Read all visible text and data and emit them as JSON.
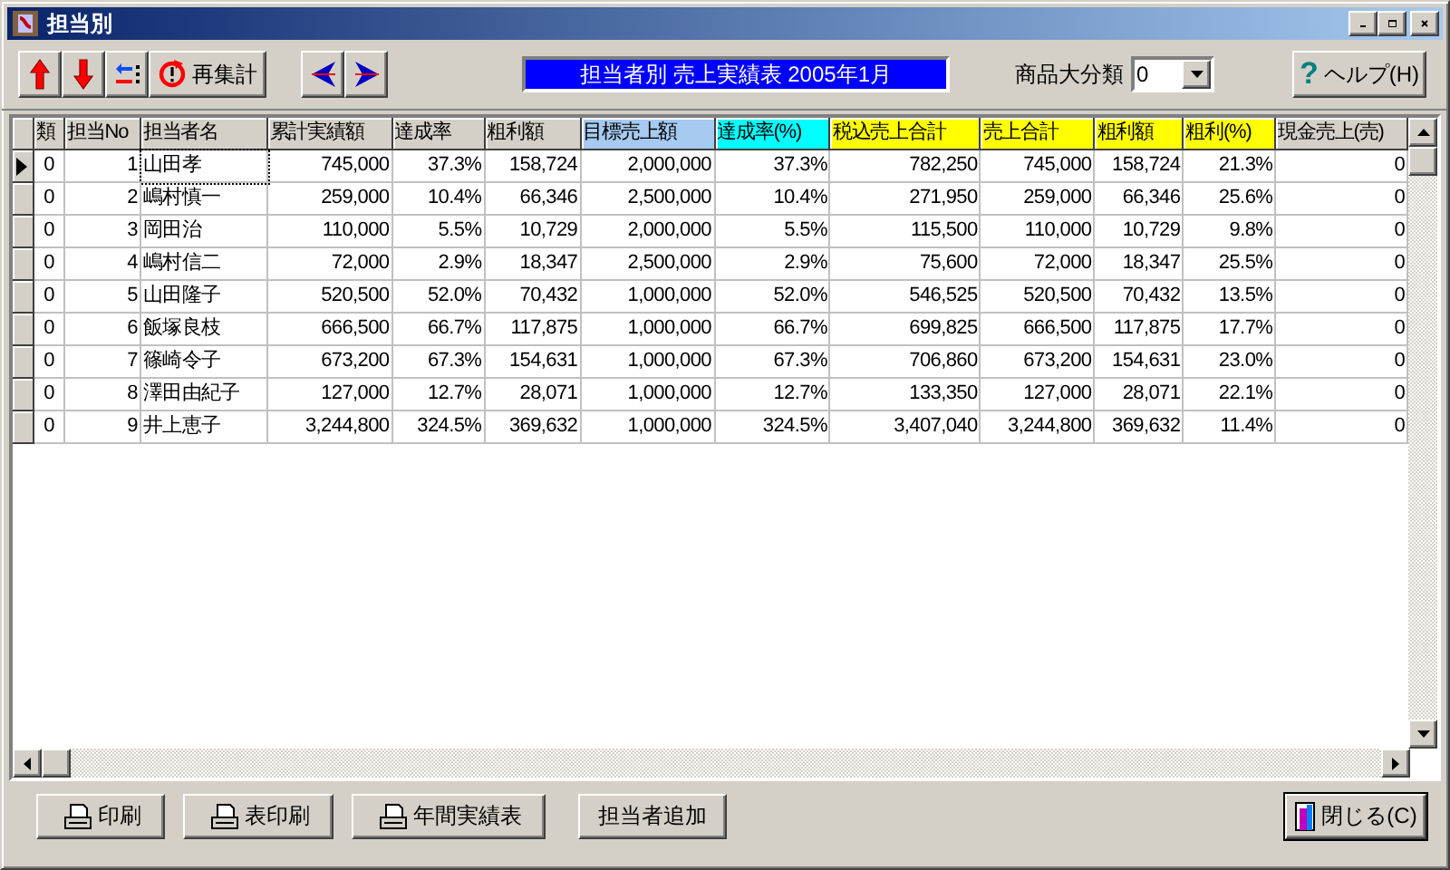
{
  "window": {
    "title": "担当別"
  },
  "toolbar": {
    "recalc_button": "再集計",
    "report_title": "担当者別  売上実績表 2005年1月",
    "category_label": "商品大分類",
    "category_value": "0",
    "help_icon": "?",
    "help_button": "ヘルプ(H)"
  },
  "table": {
    "columns": [
      {
        "label": "類",
        "color": "#d4d0c8"
      },
      {
        "label": "担当No",
        "color": "#d4d0c8"
      },
      {
        "label": "担当者名",
        "color": "#d4d0c8"
      },
      {
        "label": "累計実績額",
        "color": "#d4d0c8"
      },
      {
        "label": "達成率",
        "color": "#d4d0c8"
      },
      {
        "label": "粗利額",
        "color": "#d4d0c8"
      },
      {
        "label": "目標売上額",
        "color": "#a6caf0"
      },
      {
        "label": "達成率(%)",
        "color": "#00ffff"
      },
      {
        "label": "税込売上合計",
        "color": "#ffff00"
      },
      {
        "label": "売上合計",
        "color": "#ffff00"
      },
      {
        "label": "粗利額",
        "color": "#ffff00"
      },
      {
        "label": "粗利(%)",
        "color": "#ffff00"
      },
      {
        "label": "現金売上(売)",
        "color": "#d4d0c8"
      }
    ],
    "rows": [
      {
        "selected": true,
        "cells": [
          "0",
          "1",
          "山田孝",
          "745,000",
          "37.3%",
          "158,724",
          "2,000,000",
          "37.3%",
          "782,250",
          "745,000",
          "158,724",
          "21.3%",
          "0"
        ]
      },
      {
        "selected": false,
        "cells": [
          "0",
          "2",
          "嶋村慎一",
          "259,000",
          "10.4%",
          "66,346",
          "2,500,000",
          "10.4%",
          "271,950",
          "259,000",
          "66,346",
          "25.6%",
          "0"
        ]
      },
      {
        "selected": false,
        "cells": [
          "0",
          "3",
          "岡田治",
          "110,000",
          "5.5%",
          "10,729",
          "2,000,000",
          "5.5%",
          "115,500",
          "110,000",
          "10,729",
          "9.8%",
          "0"
        ]
      },
      {
        "selected": false,
        "cells": [
          "0",
          "4",
          "嶋村信二",
          "72,000",
          "2.9%",
          "18,347",
          "2,500,000",
          "2.9%",
          "75,600",
          "72,000",
          "18,347",
          "25.5%",
          "0"
        ]
      },
      {
        "selected": false,
        "cells": [
          "0",
          "5",
          "山田隆子",
          "520,500",
          "52.0%",
          "70,432",
          "1,000,000",
          "52.0%",
          "546,525",
          "520,500",
          "70,432",
          "13.5%",
          "0"
        ]
      },
      {
        "selected": false,
        "cells": [
          "0",
          "6",
          "飯塚良枝",
          "666,500",
          "66.7%",
          "117,875",
          "1,000,000",
          "66.7%",
          "699,825",
          "666,500",
          "117,875",
          "17.7%",
          "0"
        ]
      },
      {
        "selected": false,
        "cells": [
          "0",
          "7",
          "篠崎令子",
          "673,200",
          "67.3%",
          "154,631",
          "1,000,000",
          "67.3%",
          "706,860",
          "673,200",
          "154,631",
          "23.0%",
          "0"
        ]
      },
      {
        "selected": false,
        "cells": [
          "0",
          "8",
          "澤田由紀子",
          "127,000",
          "12.7%",
          "28,071",
          "1,000,000",
          "12.7%",
          "133,350",
          "127,000",
          "28,071",
          "22.1%",
          "0"
        ]
      },
      {
        "selected": false,
        "cells": [
          "0",
          "9",
          "井上恵子",
          "3,244,800",
          "324.5%",
          "369,632",
          "1,000,000",
          "324.5%",
          "3,407,040",
          "3,244,800",
          "369,632",
          "11.4%",
          "0"
        ]
      }
    ]
  },
  "bottom_buttons": [
    {
      "kind": "print",
      "label": "印刷"
    },
    {
      "kind": "print",
      "label": "表印刷"
    },
    {
      "kind": "print",
      "label": "年間実績表"
    },
    {
      "kind": "plain",
      "label": "担当者追加"
    }
  ],
  "close_button": "閉じる(C)"
}
